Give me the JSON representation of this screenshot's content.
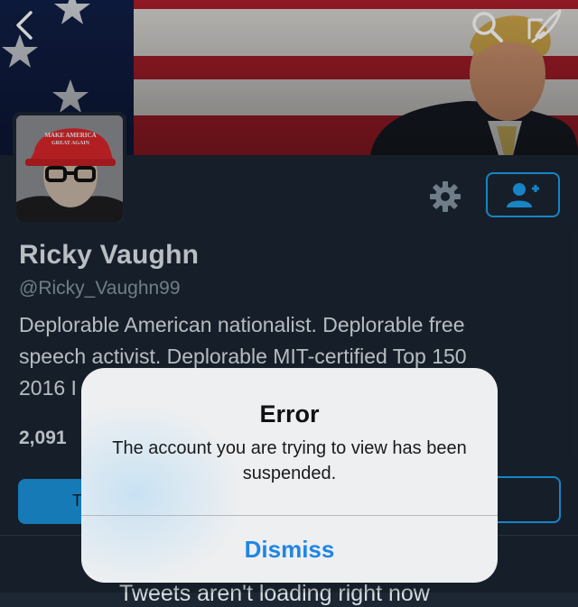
{
  "profile": {
    "display_name": "Ricky Vaughn",
    "handle": "@Ricky_Vaughn99",
    "bio_line1": "Deplorable American nationalist. Deplorable free",
    "bio_line2": "speech activist. Deplorable MIT-certified Top 150",
    "bio_line3": "2016 I",
    "stat_partial": "2,091",
    "avatar_hat_text": "MAKE AMERICA GREAT AGAIN"
  },
  "actions": {
    "back_icon": "chevron-left-icon",
    "search_icon": "search-icon",
    "compose_icon": "compose-icon",
    "settings_icon": "gear-icon",
    "follow_icon": "add-user-icon"
  },
  "tweet_button_partial": "T",
  "bottom_text_partial": "Tweets aren't loading right now",
  "alert": {
    "title": "Error",
    "message": "The account you are trying to view has been suspended.",
    "dismiss_label": "Dismiss"
  },
  "colors": {
    "accent": "#1da1f2",
    "background": "#1c2733",
    "alert_button": "#1f86e2"
  }
}
